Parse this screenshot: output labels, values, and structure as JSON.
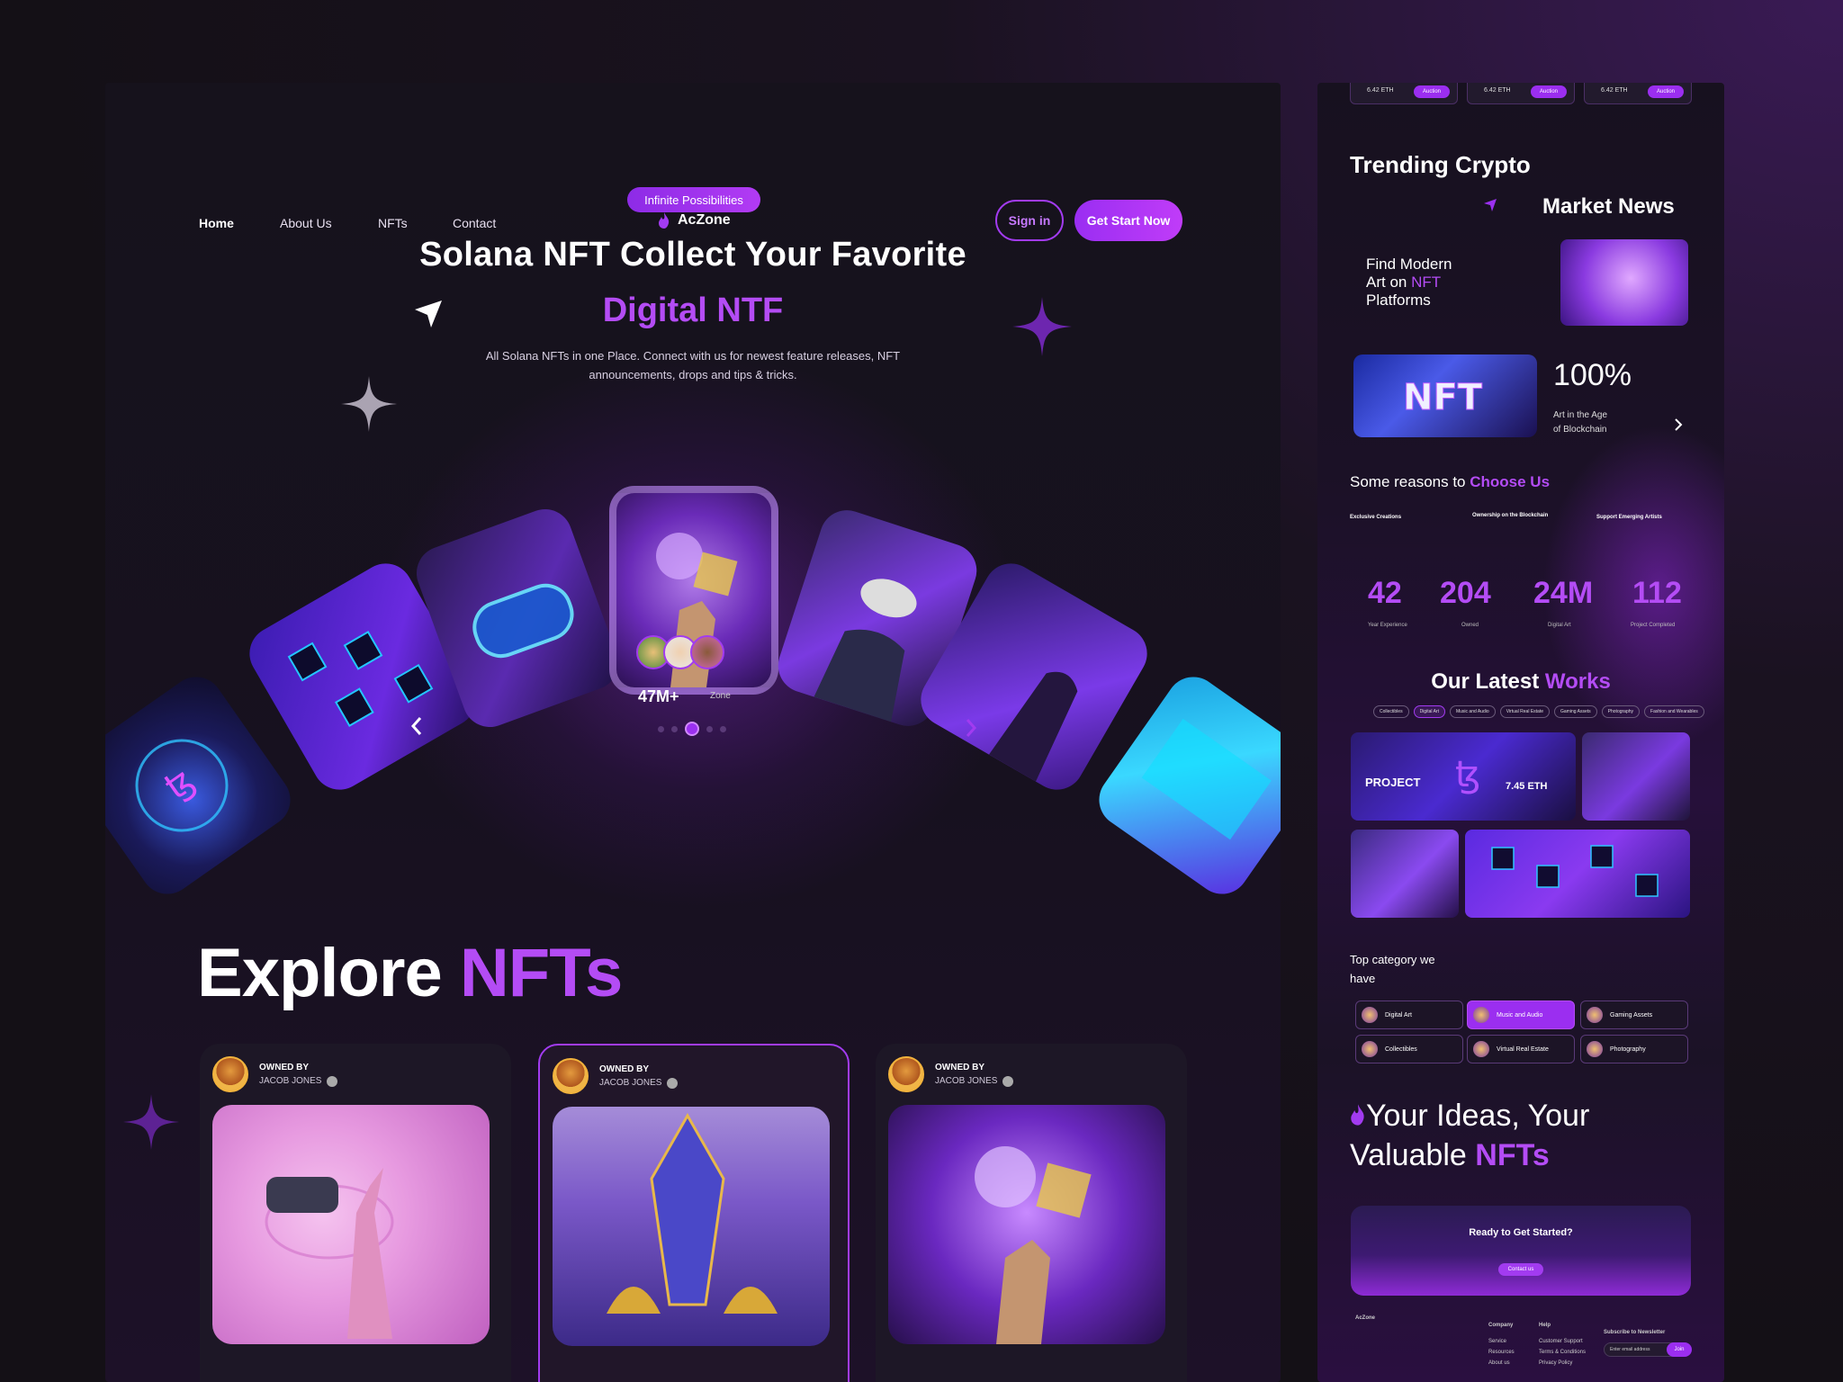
{
  "nav": {
    "home": "Home",
    "about": "About Us",
    "nfts": "NFTs",
    "contact": "Contact",
    "logo": "AcZone",
    "signin": "Sign in",
    "start": "Get Start Now"
  },
  "hero": {
    "pill": "Infinite Possibilities",
    "title": "Solana NFT Collect Your Favorite",
    "accent": "Digital NTF",
    "desc": "All Solana NFTs in one Place. Connect with us for newest feature releases, NFT announcements, drops and tips & tricks.",
    "stat": "47M+",
    "stat_label": "Zone",
    "slider_active_index": 2,
    "slider_count": 5
  },
  "explore": {
    "title": "Explore",
    "accent": "NFTs",
    "cards": [
      {
        "owned_by": "OWNED BY",
        "owner": "JACOB JONES"
      },
      {
        "owned_by": "OWNED BY",
        "owner": "JACOB JONES"
      },
      {
        "owned_by": "OWNED BY",
        "owner": "JACOB JONES"
      }
    ]
  },
  "side": {
    "auction_cards": [
      {
        "label": "6.42 ETH",
        "button": "Auction"
      },
      {
        "label": "6.42 ETH",
        "button": "Auction"
      },
      {
        "label": "6.42 ETH",
        "button": "Auction"
      }
    ],
    "trending": "Trending Crypto",
    "market_news": "Market News",
    "find_modern_1": "Find Modern",
    "find_modern_2": "Art on",
    "find_modern_nft": "NFT",
    "find_modern_3": "Platforms",
    "percent": "100%",
    "age_1": "Art in the Age",
    "age_2": "of Blockchain",
    "reasons": "Some reasons to",
    "reasons_accent": "Choose Us",
    "reason_items": [
      "Exclusive Creations",
      "Ownership on the Blockchain",
      "Support Emerging Artists"
    ],
    "stats": [
      {
        "value": "42",
        "label": "Year Experience"
      },
      {
        "value": "204",
        "label": "Owned"
      },
      {
        "value": "24M",
        "label": "Digital Art"
      },
      {
        "value": "112",
        "label": "Project Completed"
      }
    ],
    "latest": "Our Latest",
    "latest_accent": "Works",
    "tags": [
      "Collectibles",
      "Digital Art",
      "Music and Audio",
      "Virtual Real Estate",
      "Gaming Assets",
      "Photography",
      "Fashion and Wearables"
    ],
    "project_label": "PROJECT",
    "project_price": "7.45 ETH",
    "top_category_1": "Top category we",
    "top_category_2": "have",
    "categories": [
      "Digital Art",
      "Music and Audio",
      "Gaming Assets",
      "Collectibles",
      "Virtual Real Estate",
      "Photography"
    ],
    "ideas_1": "Your Ideas, Your",
    "ideas_2": "Valuable",
    "ideas_accent": "NFTs",
    "ready": "Ready to Get Started?",
    "ready_btn": "Contact us",
    "footer_logo": "AcZone",
    "footer_cols": [
      "Company",
      "Help",
      "Subscribe to Newsletter"
    ],
    "footer_links_company": [
      "Service",
      "Resources",
      "About us"
    ],
    "footer_links_help": [
      "Customer Support",
      "Terms & Conditions",
      "Privacy Policy"
    ],
    "newsletter_placeholder": "Enter email address",
    "join": "Join"
  },
  "colors": {
    "accent": "#b44cf5",
    "bg": "#16121c"
  }
}
